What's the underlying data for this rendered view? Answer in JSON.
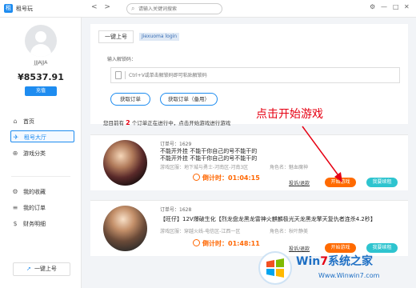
{
  "app": {
    "name": "租号玩"
  },
  "titlebar": {
    "nav_arrows": "< >",
    "search_placeholder": "请输入关键词搜索",
    "controls": [
      "⚙",
      "—",
      "□",
      "✕"
    ]
  },
  "sidebar": {
    "username": "JJJAJJA",
    "balance": "¥8537.91",
    "recharge_label": "充值",
    "nav": [
      {
        "label": "首页",
        "icon": "home-icon",
        "glyph": "⌂",
        "active": false
      },
      {
        "label": "租号大厅",
        "icon": "lobby-icon",
        "glyph": "✈",
        "active": true
      },
      {
        "label": "游戏分类",
        "icon": "category-icon",
        "glyph": "⊕",
        "active": false
      }
    ],
    "nav2": [
      {
        "label": "我的收藏",
        "icon": "favorite-icon",
        "glyph": "⚙"
      },
      {
        "label": "我的订单",
        "icon": "orders-icon",
        "glyph": "≡"
      },
      {
        "label": "财务明细",
        "icon": "finance-icon",
        "glyph": "$"
      }
    ],
    "onekey_label": "一键上号"
  },
  "main": {
    "tab_label": "一键上号",
    "tab_sub": "Jiexuoma login",
    "code_label": "输入解锁码：",
    "code_placeholder": "Ctrl+V或单击解锁码即可粘贴解锁码",
    "btn_get": "获取订单",
    "btn_get_backup": "获取订单（备用）",
    "summary_prefix": "您目前有",
    "summary_count": "2",
    "summary_suffix": "个订单正在进行中，点击开始游戏进行游戏"
  },
  "orders": [
    {
      "order_no": "订单号：1629",
      "title": "不能开外挂 不能干你自己的号不能干的",
      "title2": "不能开外挂 不能干你自己的号不能干的",
      "region": "游戏区服：地下城与勇士-河南区-河南3区",
      "role": "角色名：魅血魔神",
      "timer_label": "倒计时：",
      "timer": "01:04:15",
      "complain": "投诉/退款",
      "start": "开始游戏",
      "fix": "我要续租"
    },
    {
      "order_no": "订单号：1628",
      "title": "【旺仔】12V爆破生化【烈龙盘龙黑龙雷神火麒麟极光天龙黑龙擎天复仇者连杀4.2秒】",
      "region": "游戏区服：穿越火线-电信区-江西一区",
      "role": "角色名：秋叶静美",
      "timer_label": "倒计时：",
      "timer": "01:48:11",
      "complain": "投诉/退款",
      "start": "开始游戏",
      "fix": "我要续租"
    }
  ],
  "annotation": "点击开始游戏",
  "watermark": {
    "brand_a": "Win",
    "brand_b": "7",
    "brand_c": "系统之家",
    "url": "Www.Winwin7.com"
  }
}
